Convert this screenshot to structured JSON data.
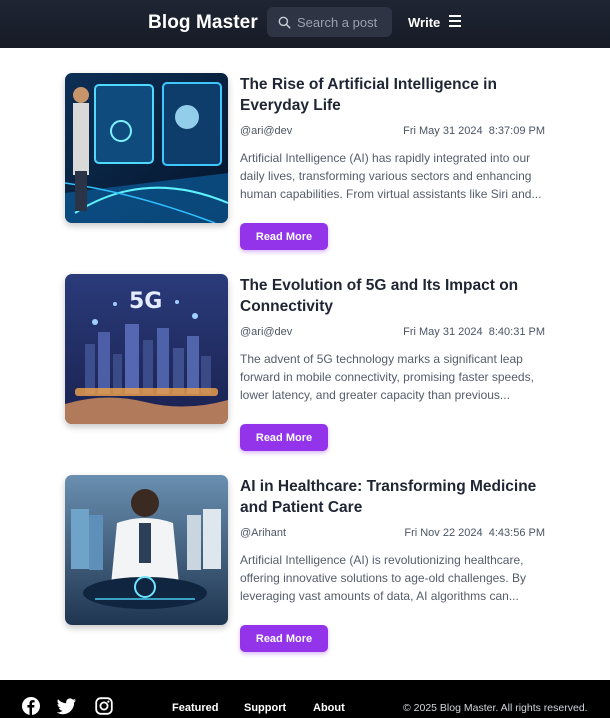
{
  "header": {
    "brand": "Blog Master",
    "search_placeholder": "Search a post",
    "write_label": "Write",
    "icons": [
      "search-icon",
      "menu-icon"
    ]
  },
  "posts": [
    {
      "title": "The Rise of Artificial Intelligence in Everyday Life",
      "author": "@ari@dev",
      "date": "Fri May 31 2024  8:37:09 PM",
      "excerpt": "Artificial Intelligence (AI) has rapidly integrated into our daily lives, transforming various sectors and enhancing human capabilities. From virtual assistants like Siri and...",
      "button": "Read More",
      "image": "ai-holographic-interface-image"
    },
    {
      "title": "The Evolution of 5G and Its Impact on Connectivity",
      "author": "@ari@dev",
      "date": "Fri May 31 2024  8:40:31 PM",
      "excerpt": "The advent of 5G technology marks a significant leap forward in mobile connectivity, promising faster speeds, lower latency, and greater capacity than previous...",
      "button": "Read More",
      "image": "5g-smart-city-image",
      "image_text": "5G"
    },
    {
      "title": "AI in Healthcare: Transforming Medicine and Patient Care",
      "author": "@Arihant",
      "date": "Fri Nov 22 2024  4:43:56 PM",
      "excerpt": "Artificial Intelligence (AI) is revolutionizing healthcare, offering innovative solutions to age-old challenges. By leveraging vast amounts of data, AI algorithms can...",
      "button": "Read More",
      "image": "ai-healthcare-doctors-image"
    }
  ],
  "footer": {
    "social_icons": [
      "facebook-icon",
      "twitter-icon",
      "instagram-icon"
    ],
    "links": [
      "Featured",
      "Support",
      "About"
    ],
    "copyright": "© 2025 Blog Master. All rights reserved."
  },
  "colors": {
    "header_bg": "#1f2533",
    "accent": "#9333ea",
    "footer_bg": "#000000"
  }
}
